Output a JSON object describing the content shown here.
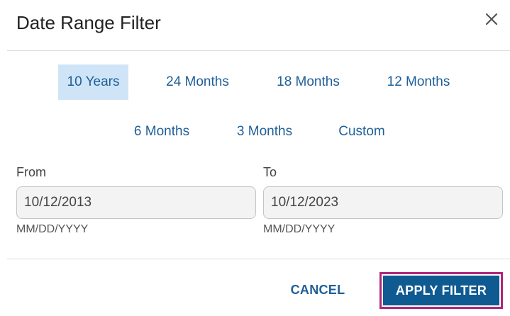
{
  "dialog": {
    "title": "Date Range Filter",
    "close_icon": "close-icon"
  },
  "presets": [
    {
      "label": "10 Years",
      "active": true
    },
    {
      "label": "24 Months",
      "active": false
    },
    {
      "label": "18 Months",
      "active": false
    },
    {
      "label": "12 Months",
      "active": false
    },
    {
      "label": "6 Months",
      "active": false
    },
    {
      "label": "3 Months",
      "active": false
    },
    {
      "label": "Custom",
      "active": false
    }
  ],
  "from": {
    "label": "From",
    "value": "10/12/2013",
    "hint": "MM/DD/YYYY"
  },
  "to": {
    "label": "To",
    "value": "10/12/2023",
    "hint": "MM/DD/YYYY"
  },
  "actions": {
    "cancel_label": "CANCEL",
    "apply_label": "APPLY FILTER"
  },
  "colors": {
    "accent": "#1f5f99",
    "primary_button": "#0e5a91",
    "active_preset_bg": "#cfe5f7",
    "highlight_border": "#b0267a"
  }
}
